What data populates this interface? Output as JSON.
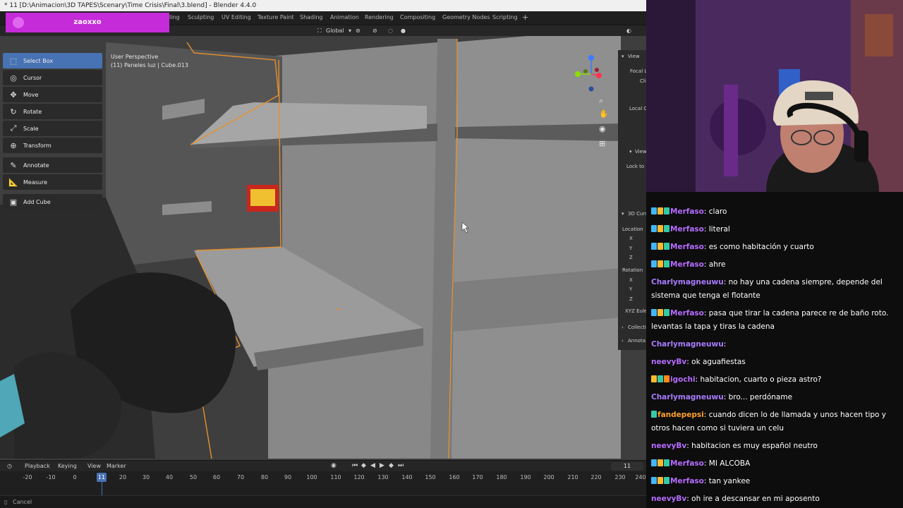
{
  "window": {
    "title": "* 11 [D:\\Animacion\\3D TAPES\\Scenary\\Time Crisis\\Final\\3.blend] - Blender 4.4.0"
  },
  "workspace_tabs": [
    "Sculpting",
    "UV Editing",
    "Texture Paint",
    "Shading",
    "Animation",
    "Rendering",
    "Compositing",
    "Geometry Nodes",
    "Scripting"
  ],
  "workspace_tab_partial": "ling",
  "workspace_add": "+",
  "header": {
    "orientation": "Global"
  },
  "viewport": {
    "perspective": "User Perspective",
    "collection_object": "(11) Paneles luz | Cube.013"
  },
  "tools": [
    {
      "label": "Select Box",
      "icon": "select-box-icon",
      "glyph": "⬚",
      "active": true
    },
    {
      "label": "Cursor",
      "icon": "cursor-icon",
      "glyph": "◎"
    },
    {
      "label": "Move",
      "icon": "move-icon",
      "glyph": "✥"
    },
    {
      "label": "Rotate",
      "icon": "rotate-icon",
      "glyph": "↻"
    },
    {
      "label": "Scale",
      "icon": "scale-icon",
      "glyph": "⤢"
    },
    {
      "label": "Transform",
      "icon": "transform-icon",
      "glyph": "⊕"
    },
    {
      "label": "Annotate",
      "icon": "annotate-icon",
      "glyph": "✎"
    },
    {
      "label": "Measure",
      "icon": "measure-icon",
      "glyph": "📐"
    },
    {
      "label": "Add Cube",
      "icon": "add-cube-icon",
      "glyph": "▣"
    }
  ],
  "npanel": {
    "view_tab": "View",
    "focal": "Focal L",
    "clip": "Cli",
    "local_camera": "Local C",
    "view_section": "View",
    "lock_to": "Lock to",
    "cursor_tab": "3D Curs",
    "location": "Location",
    "x": "X",
    "y": "Y",
    "z": "Z",
    "rotation": "Rotation",
    "euler": "XYZ Eule",
    "collections": "Collecti",
    "annotations": "Annota"
  },
  "timeline": {
    "menus": [
      "Playback",
      "Keying",
      "View",
      "Marker"
    ],
    "current_frame": "11",
    "ticks": [
      "-20",
      "-10",
      "0",
      "11",
      "20",
      "30",
      "40",
      "50",
      "60",
      "70",
      "80",
      "90",
      "100",
      "110",
      "120",
      "130",
      "140",
      "150",
      "160",
      "170",
      "180",
      "190",
      "200",
      "210",
      "220",
      "230",
      "240"
    ]
  },
  "status": {
    "text": "Cancel"
  },
  "stream": {
    "name": "zaoxxo"
  },
  "chat": [
    {
      "user": "Merfaso",
      "color": "#b56cff",
      "badges": [
        "#3fb7ff",
        "#ffb92d",
        "#35c9a5"
      ],
      "text": "claro"
    },
    {
      "user": "Merfaso",
      "color": "#b56cff",
      "badges": [
        "#3fb7ff",
        "#ffb92d",
        "#35c9a5"
      ],
      "text": "literal"
    },
    {
      "user": "Merfaso",
      "color": "#b56cff",
      "badges": [
        "#3fb7ff",
        "#ffb92d",
        "#35c9a5"
      ],
      "text": "es como habitación y cuarto"
    },
    {
      "user": "Merfaso",
      "color": "#b56cff",
      "badges": [
        "#3fb7ff",
        "#ffb92d",
        "#35c9a5"
      ],
      "text": "ahre"
    },
    {
      "user": "Charlymagneuwu",
      "color": "#a87bff",
      "badges": [],
      "text": "no hay una cadena siempre, depende del sistema que tenga el flotante"
    },
    {
      "user": "Merfaso",
      "color": "#b56cff",
      "badges": [
        "#3fb7ff",
        "#ffb92d",
        "#35c9a5"
      ],
      "text": "pasa que tirar la cadena parece re de baño roto. levantas la tapa y tiras la cadena"
    },
    {
      "user": "Charlymagneuwu",
      "color": "#a87bff",
      "badges": [],
      "text": ""
    },
    {
      "user": "neevyBv",
      "color": "#b56cff",
      "badges": [],
      "text": "ok aguafiestas"
    },
    {
      "user": "igochi",
      "color": "#b56cff",
      "badges": [
        "#ffb92d",
        "#35c9a5",
        "#ff8a1c"
      ],
      "text": "habitacion, cuarto o pieza astro?"
    },
    {
      "user": "Charlymagneuwu",
      "color": "#a87bff",
      "badges": [],
      "text": "bro... perdóname"
    },
    {
      "user": "fandepepsi",
      "color": "#ff9f2e",
      "badges": [
        "#35c9a5"
      ],
      "text": "cuando dicen lo de llamada y unos hacen tipo y otros hacen como si tuviera un celu"
    },
    {
      "user": "neevyBv",
      "color": "#b56cff",
      "badges": [],
      "text": "habitacion es muy español neutro"
    },
    {
      "user": "Merfaso",
      "color": "#b56cff",
      "badges": [
        "#3fb7ff",
        "#ffb92d",
        "#35c9a5"
      ],
      "text": "MI ALCOBA"
    },
    {
      "user": "Merfaso",
      "color": "#b56cff",
      "badges": [
        "#3fb7ff",
        "#ffb92d",
        "#35c9a5"
      ],
      "text": "tan yankee"
    },
    {
      "user": "neevyBv",
      "color": "#b56cff",
      "badges": [],
      "text": "oh ire a descansar en mi aposento"
    }
  ]
}
